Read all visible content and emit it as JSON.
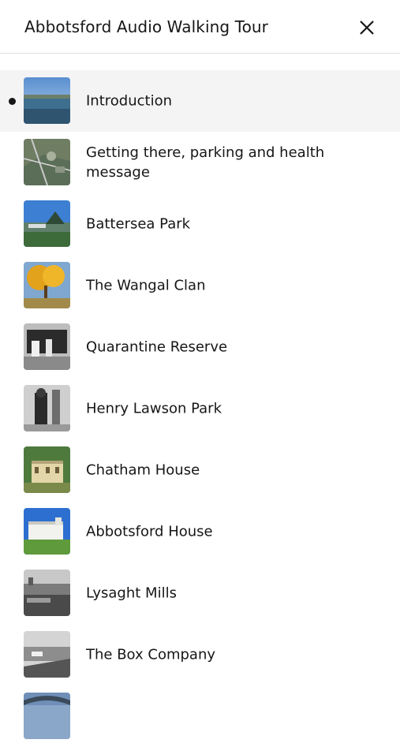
{
  "header": {
    "title": "Abbotsford Audio Walking Tour"
  },
  "stops": [
    {
      "label": "Introduction",
      "active": true
    },
    {
      "label": "Getting there, parking and health message",
      "active": false
    },
    {
      "label": "Battersea Park",
      "active": false
    },
    {
      "label": "The Wangal Clan",
      "active": false
    },
    {
      "label": "Quarantine Reserve",
      "active": false
    },
    {
      "label": "Henry Lawson Park",
      "active": false
    },
    {
      "label": "Chatham House",
      "active": false
    },
    {
      "label": "Abbotsford House",
      "active": false
    },
    {
      "label": "Lysaght Mills",
      "active": false
    },
    {
      "label": "The Box Company",
      "active": false
    }
  ]
}
